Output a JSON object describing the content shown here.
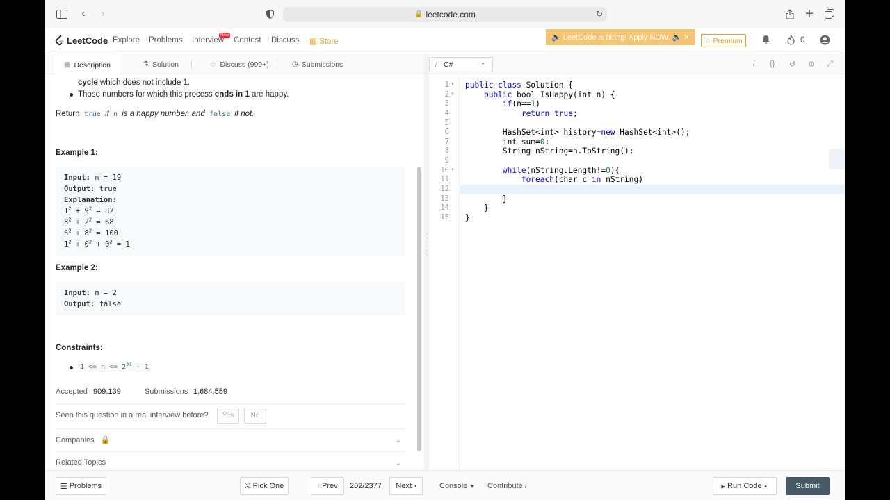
{
  "browser": {
    "url": "leetcode.com"
  },
  "nav": {
    "logo": "LeetCode",
    "items": [
      "Explore",
      "Problems",
      "Interview",
      "Contest",
      "Discuss",
      "Store"
    ],
    "new_badge": "New",
    "hiring": "LeetCode is hiring! Apply NOW.",
    "premium": "Premium",
    "coins": "0"
  },
  "tabs": [
    "Description",
    "Solution",
    "Discuss (999+)",
    "Submissions"
  ],
  "description": {
    "bullet1_bold": "cycle",
    "bullet1_rest": "which does not include 1.",
    "bullet2_a": "Those numbers for which this process",
    "bullet2_bold": "ends in 1",
    "bullet2_b": "are happy.",
    "return_a": "Return",
    "return_true": "true",
    "return_if": "if",
    "return_n": "n",
    "return_mid": "is a happy number, and",
    "return_false": "false",
    "return_end": "if not.",
    "example1_title": "Example 1:",
    "example1": {
      "input_label": "Input:",
      "input": "n = 19",
      "output_label": "Output:",
      "output": "true",
      "explanation_label": "Explanation:",
      "lines": [
        {
          "a": "1",
          "b": "9",
          "sep": " + ",
          "res": " = 82"
        },
        {
          "a": "8",
          "b": "2",
          "sep": " + ",
          "res": " = 68"
        },
        {
          "a": "6",
          "b": "8",
          "sep": " + ",
          "res": " = 100"
        }
      ],
      "last": {
        "a": "1",
        "b": "0",
        "c": "0",
        "res": " = 1"
      },
      "exp": "2"
    },
    "example2_title": "Example 2:",
    "example2": {
      "input_label": "Input:",
      "input": "n = 2",
      "output_label": "Output:",
      "output": "false"
    },
    "constraints_title": "Constraints:",
    "constraint": "1 <= n <= 2",
    "constraint_exp": "31",
    "constraint_tail": " - 1",
    "accepted_label": "Accepted",
    "accepted": "909,139",
    "submissions_label": "Submissions",
    "submissions": "1,684,559",
    "seen": "Seen this question in a real interview before?",
    "yes": "Yes",
    "no": "No",
    "companies": "Companies",
    "related": "Related Topics"
  },
  "editor": {
    "language": "C#",
    "line_numbers": [
      "1",
      "2",
      "3",
      "4",
      "5",
      "6",
      "7",
      "8",
      "9",
      "10",
      "11",
      "12",
      "13",
      "14",
      "15"
    ]
  },
  "bottom": {
    "problems": "Problems",
    "pick_one": "Pick One",
    "prev": "Prev",
    "page": "202/2377",
    "next": "Next",
    "console": "Console",
    "contribute": "Contribute",
    "run_code": "Run Code",
    "submit": "Submit"
  }
}
